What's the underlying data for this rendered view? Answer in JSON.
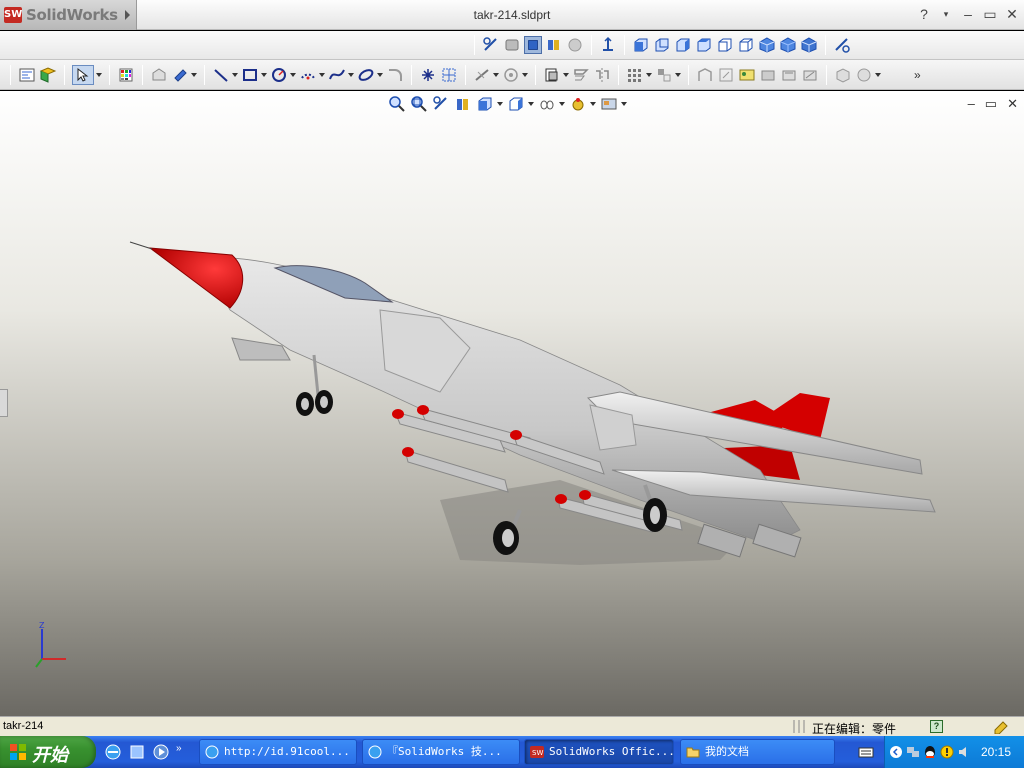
{
  "app": {
    "brand": "SolidWorks",
    "brand_badge": "SW",
    "document_title": "takr-214.sldprt",
    "title_controls": [
      "?",
      "–",
      "▭",
      "✕"
    ]
  },
  "command_bar": {
    "icons": [
      "section-view-icon",
      "view-orientation-icon",
      "display-style-icon",
      "shaded-icon",
      "hidden-lines-icon",
      "front-view-icon",
      "back-view-icon",
      "left-view-icon",
      "right-view-icon",
      "top-view-icon",
      "bottom-view-icon",
      "isometric-view-icon",
      "trimetric-view-icon",
      "dimetric-view-icon",
      "normal-to-icon"
    ]
  },
  "sketch_toolbar": {
    "icons": [
      "sketch-icon",
      "smart-dimension-icon",
      "line-icon",
      "rectangle-icon",
      "circle-icon",
      "arc-icon",
      "spline-icon",
      "ellipse-icon",
      "fillet-icon",
      "point-icon",
      "centerline-icon",
      "trim-icon",
      "offset-icon",
      "mirror-icon",
      "linear-pattern-icon"
    ]
  },
  "view_toolbar": {
    "icons": [
      "zoom-to-fit-icon",
      "zoom-area-icon",
      "previous-view-icon",
      "section-view-icon",
      "view-orientation-icon",
      "display-style-icon",
      "hide-show-icon",
      "edit-appearance-icon",
      "apply-scene-icon"
    ]
  },
  "viewport": {
    "controls": [
      "–",
      "▭",
      "✕"
    ],
    "triad": {
      "z": "Z",
      "x": "X",
      "y": "Y"
    },
    "colors": {
      "accent_red": "#d40000",
      "body_gray": "#c8c8c8"
    }
  },
  "status_bar": {
    "part_name": "takr-214",
    "editing_status": "正在编辑：零件",
    "help_label": "?"
  },
  "taskbar": {
    "start_label": "开始",
    "tasks": [
      {
        "label": "http://id.91cool...",
        "icon": "ie-icon",
        "active": false
      },
      {
        "label": "『SolidWorks 技...",
        "icon": "ie-icon",
        "active": false
      },
      {
        "label": "SolidWorks Offic...",
        "icon": "solidworks-icon",
        "active": true
      },
      {
        "label": "我的文档",
        "icon": "folder-icon",
        "active": false
      }
    ],
    "clock": "20:15"
  }
}
